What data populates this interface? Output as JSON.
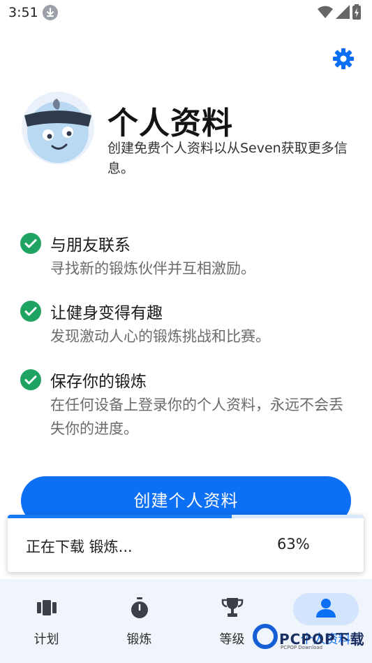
{
  "status_bar": {
    "time": "3:51"
  },
  "profile": {
    "title": "个人资料",
    "subtitle": "创建免费个人资料以从Seven获取更多信息。"
  },
  "features": [
    {
      "title": "与朋友联系",
      "description": "寻找新的锻炼伙伴并互相激励。"
    },
    {
      "title": "让健身变得有趣",
      "description": "发现激动人心的锻炼挑战和比赛。"
    },
    {
      "title": "保存你的锻炼",
      "description": "在任何设备上登录你的个人资料，永远不会丢失你的进度。"
    }
  ],
  "create_button": {
    "label": "创建个人资料"
  },
  "download_toast": {
    "text": "正在下载 锻炼...",
    "percent_label": "63%",
    "progress": 0.63
  },
  "bottom_nav": {
    "items": [
      {
        "label": "计划",
        "icon": "cards-icon",
        "active": false
      },
      {
        "label": "锻炼",
        "icon": "stopwatch-icon",
        "active": false
      },
      {
        "label": "等级",
        "icon": "trophy-icon",
        "active": false
      },
      {
        "label": "个人资料",
        "icon": "person-icon",
        "active": true
      }
    ]
  },
  "watermark": {
    "brand": "PCPOP下载",
    "sub": "PCPOP Download"
  },
  "colors": {
    "accent": "#0d6ff4",
    "check": "#1ea362",
    "nav_bg": "#f0f4fb",
    "nav_active": "#d3e4fd"
  }
}
